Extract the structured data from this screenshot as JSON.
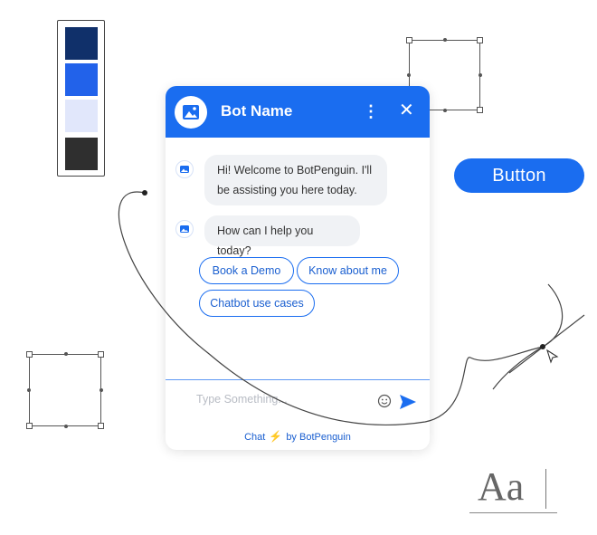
{
  "palette": {
    "colors": [
      "#10306a",
      "#2262ea",
      "#e1e7fb",
      "#2f2f2f"
    ]
  },
  "button": {
    "label": "Button"
  },
  "chat": {
    "header": {
      "title": "Bot Name",
      "color": "#1a6df0",
      "menu_icon": "more-vertical-icon",
      "close_icon": "close-icon"
    },
    "messages": [
      {
        "text_line1": "Hi! Welcome to BotPenguin. I'll",
        "text_line2": "be assisting you here today."
      },
      {
        "text": "How can I help you today?"
      }
    ],
    "quick_replies": [
      "Book a Demo",
      "Know about me",
      "Chatbot use cases"
    ],
    "input": {
      "placeholder": "Type Something..."
    },
    "footer": {
      "prefix": "Chat",
      "suffix": "by BotPenguin"
    }
  },
  "typography_sample": {
    "text": "Aa"
  }
}
